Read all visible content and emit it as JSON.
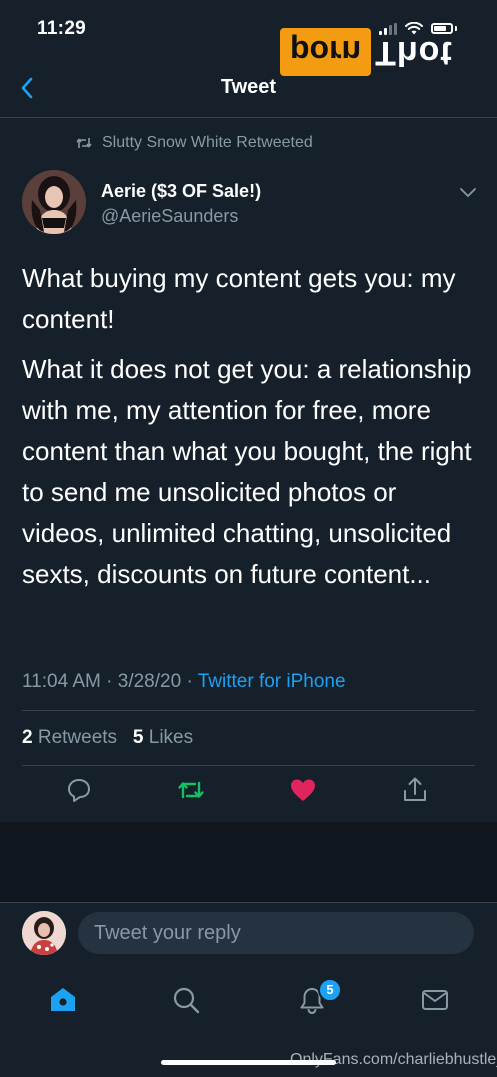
{
  "status_bar": {
    "time": "11:29"
  },
  "watermark": {
    "box_text": "porn",
    "text": "Thot"
  },
  "header": {
    "title": "Tweet"
  },
  "retweet_context": {
    "text": "Slutty Snow White Retweeted"
  },
  "author": {
    "name": "Aerie ($3 OF Sale!)",
    "handle": "@AerieSaunders"
  },
  "tweet": {
    "paragraphs": [
      "What buying my content gets you: my content!",
      "What it does not get you: a relationship with me, my attention for free, more content than what you bought, the right to send me unsolicited photos or videos, unlimited chatting, unsolicited sexts, discounts on future content..."
    ],
    "time": "11:04 AM",
    "separator": "·",
    "date": "3/28/20",
    "source": "Twitter for iPhone"
  },
  "stats": {
    "retweets_count": "2",
    "retweets_label": "Retweets",
    "likes_count": "5",
    "likes_label": "Likes"
  },
  "reply": {
    "placeholder": "Tweet your reply"
  },
  "tabbar": {
    "notifications_badge": "5"
  },
  "footer_watermark": "OnlyFans.com/charliebhustle_",
  "colors": {
    "background": "#15202b",
    "accent": "#1da1f2",
    "retweet_green": "#17bf63",
    "like_red": "#e0245e",
    "secondary_text": "#8899a6",
    "watermark_orange": "#f39c12"
  },
  "icons": [
    "back-chevron-icon",
    "retweet-icon",
    "chevron-down-icon",
    "reply-icon",
    "like-icon",
    "share-icon",
    "home-icon",
    "search-icon",
    "notifications-icon",
    "messages-icon"
  ]
}
